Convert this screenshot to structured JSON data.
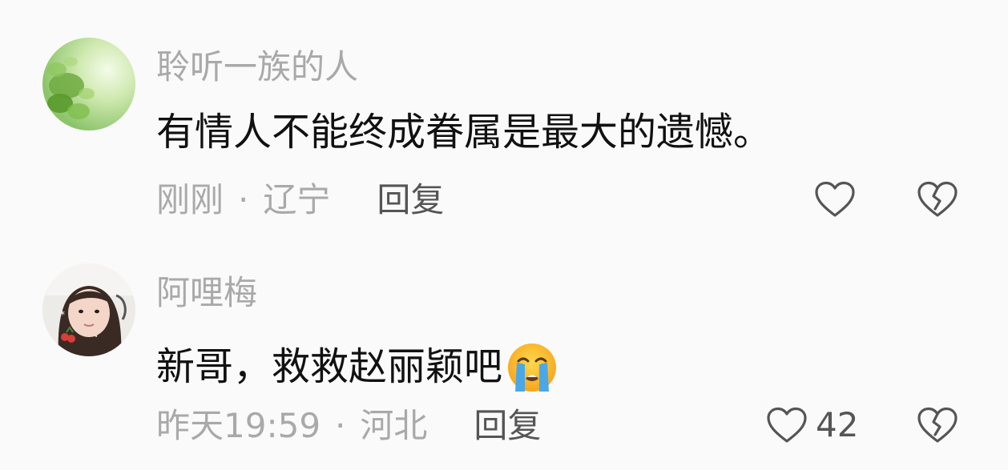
{
  "comments": [
    {
      "username": "聆听一族的人",
      "text": "有情人不能终成眷属是最大的遗憾。",
      "time": "刚刚",
      "separator": "·",
      "location": "辽宁",
      "reply_label": "回复",
      "like_count": "",
      "avatar_icon": "green-leaves-avatar"
    },
    {
      "username": "阿哩梅",
      "text": "新哥，救救赵丽颖吧",
      "emoji_icon": "loudly-crying-face-emoji",
      "time": "昨天19:59",
      "separator": "·",
      "location": "河北",
      "reply_label": "回复",
      "like_count": "42",
      "avatar_icon": "girl-photo-avatar"
    }
  ],
  "colors": {
    "background": "#fafafa",
    "username": "#a9a9a9",
    "text": "#111111",
    "meta": "#a9a9a9",
    "reply": "#555555",
    "icon": "#555555"
  }
}
